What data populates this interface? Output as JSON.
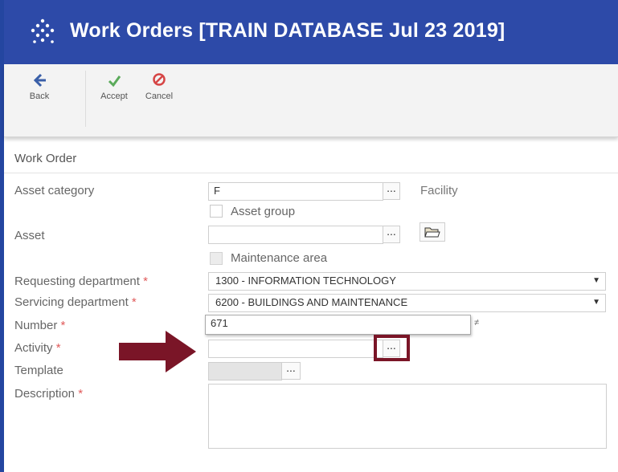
{
  "app": {
    "title": "Work Orders [TRAIN DATABASE Jul 23 2019]"
  },
  "toolbar": {
    "back_label": "Back",
    "accept_label": "Accept",
    "cancel_label": "Cancel",
    "icons": {
      "back": "arrow-left-icon",
      "accept": "checkmark-icon",
      "cancel": "prohibited-icon"
    },
    "colors": {
      "back": "#3a5fa8",
      "accept": "#5aaa5a",
      "cancel": "#d64545"
    }
  },
  "form": {
    "section_title": "Work Order",
    "asset_category": {
      "label": "Asset category",
      "value": "F",
      "description": "Facility"
    },
    "asset_group": {
      "label": "Asset group",
      "checked": false
    },
    "asset": {
      "label": "Asset",
      "value": "",
      "icon": "folder-open-icon"
    },
    "maintenance_area": {
      "label": "Maintenance area",
      "checked": false,
      "disabled": true
    },
    "requesting_department": {
      "label": "Requesting department",
      "required_mark": "*",
      "value": "1300 - INFORMATION TECHNOLOGY"
    },
    "servicing_department": {
      "label": "Servicing department",
      "required_mark": "*",
      "value": "6200 - BUILDINGS AND MAINTENANCE"
    },
    "number": {
      "label": "Number",
      "required_mark": "*",
      "value": "671"
    },
    "activity": {
      "label": "Activity",
      "required_mark": "*",
      "value": ""
    },
    "template": {
      "label": "Template",
      "value": ""
    },
    "description": {
      "label": "Description",
      "required_mark": "*",
      "value": ""
    },
    "ellipsis": "..."
  },
  "annotation": {
    "color": "#7a1527"
  }
}
